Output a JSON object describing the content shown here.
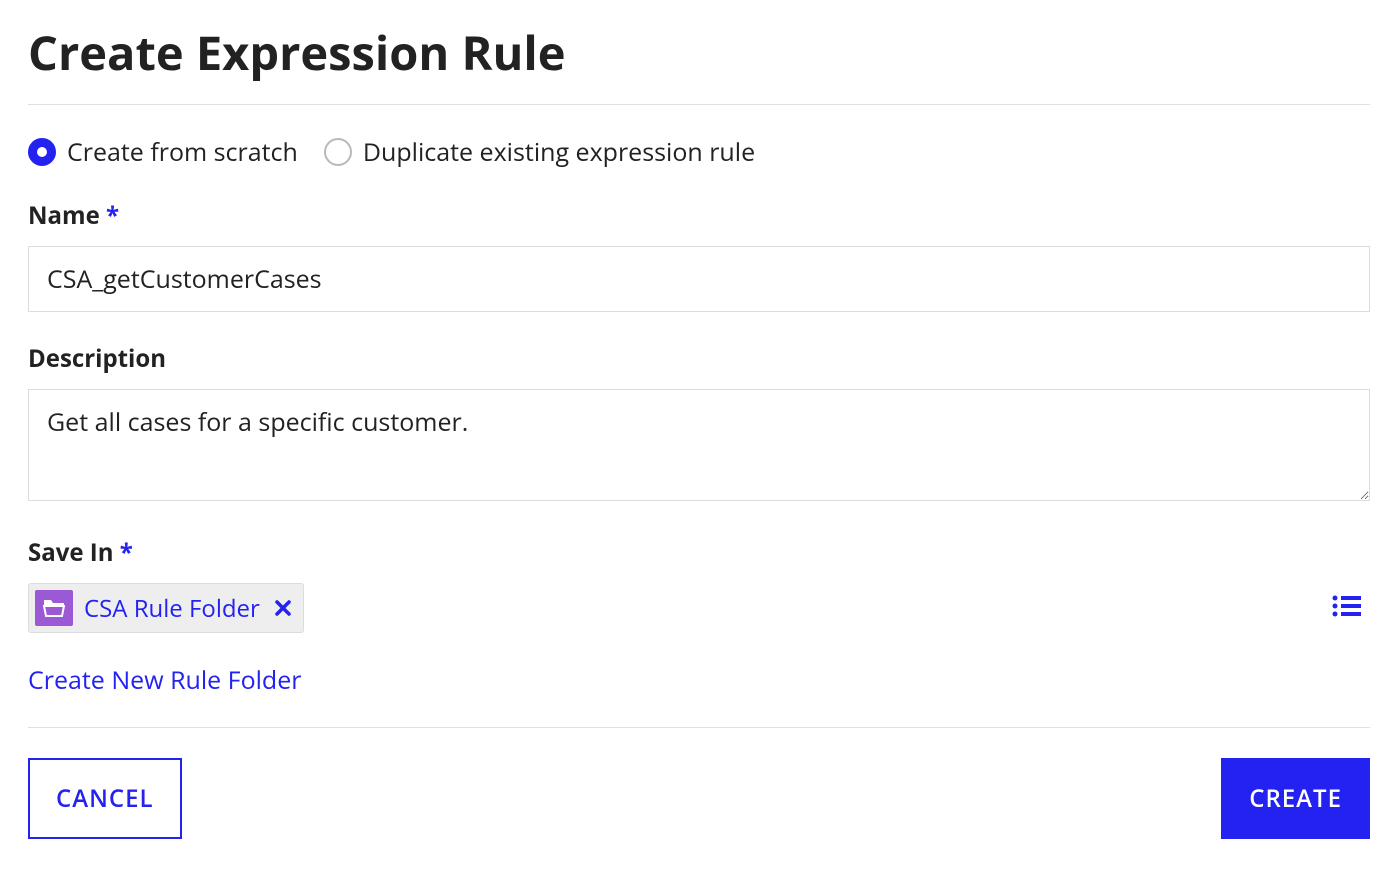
{
  "header": {
    "title": "Create Expression Rule"
  },
  "mode": {
    "scratch_label": "Create from scratch",
    "duplicate_label": "Duplicate existing expression rule",
    "selected": "scratch"
  },
  "fields": {
    "name_label": "Name",
    "name_value": "CSA_getCustomerCases",
    "description_label": "Description",
    "description_value": "Get all cases for a specific customer.",
    "save_in_label": "Save In"
  },
  "save_in": {
    "chip_label": "CSA Rule Folder",
    "create_new_link": "Create New Rule Folder"
  },
  "buttons": {
    "cancel": "CANCEL",
    "create": "CREATE"
  },
  "required_marker": "*"
}
